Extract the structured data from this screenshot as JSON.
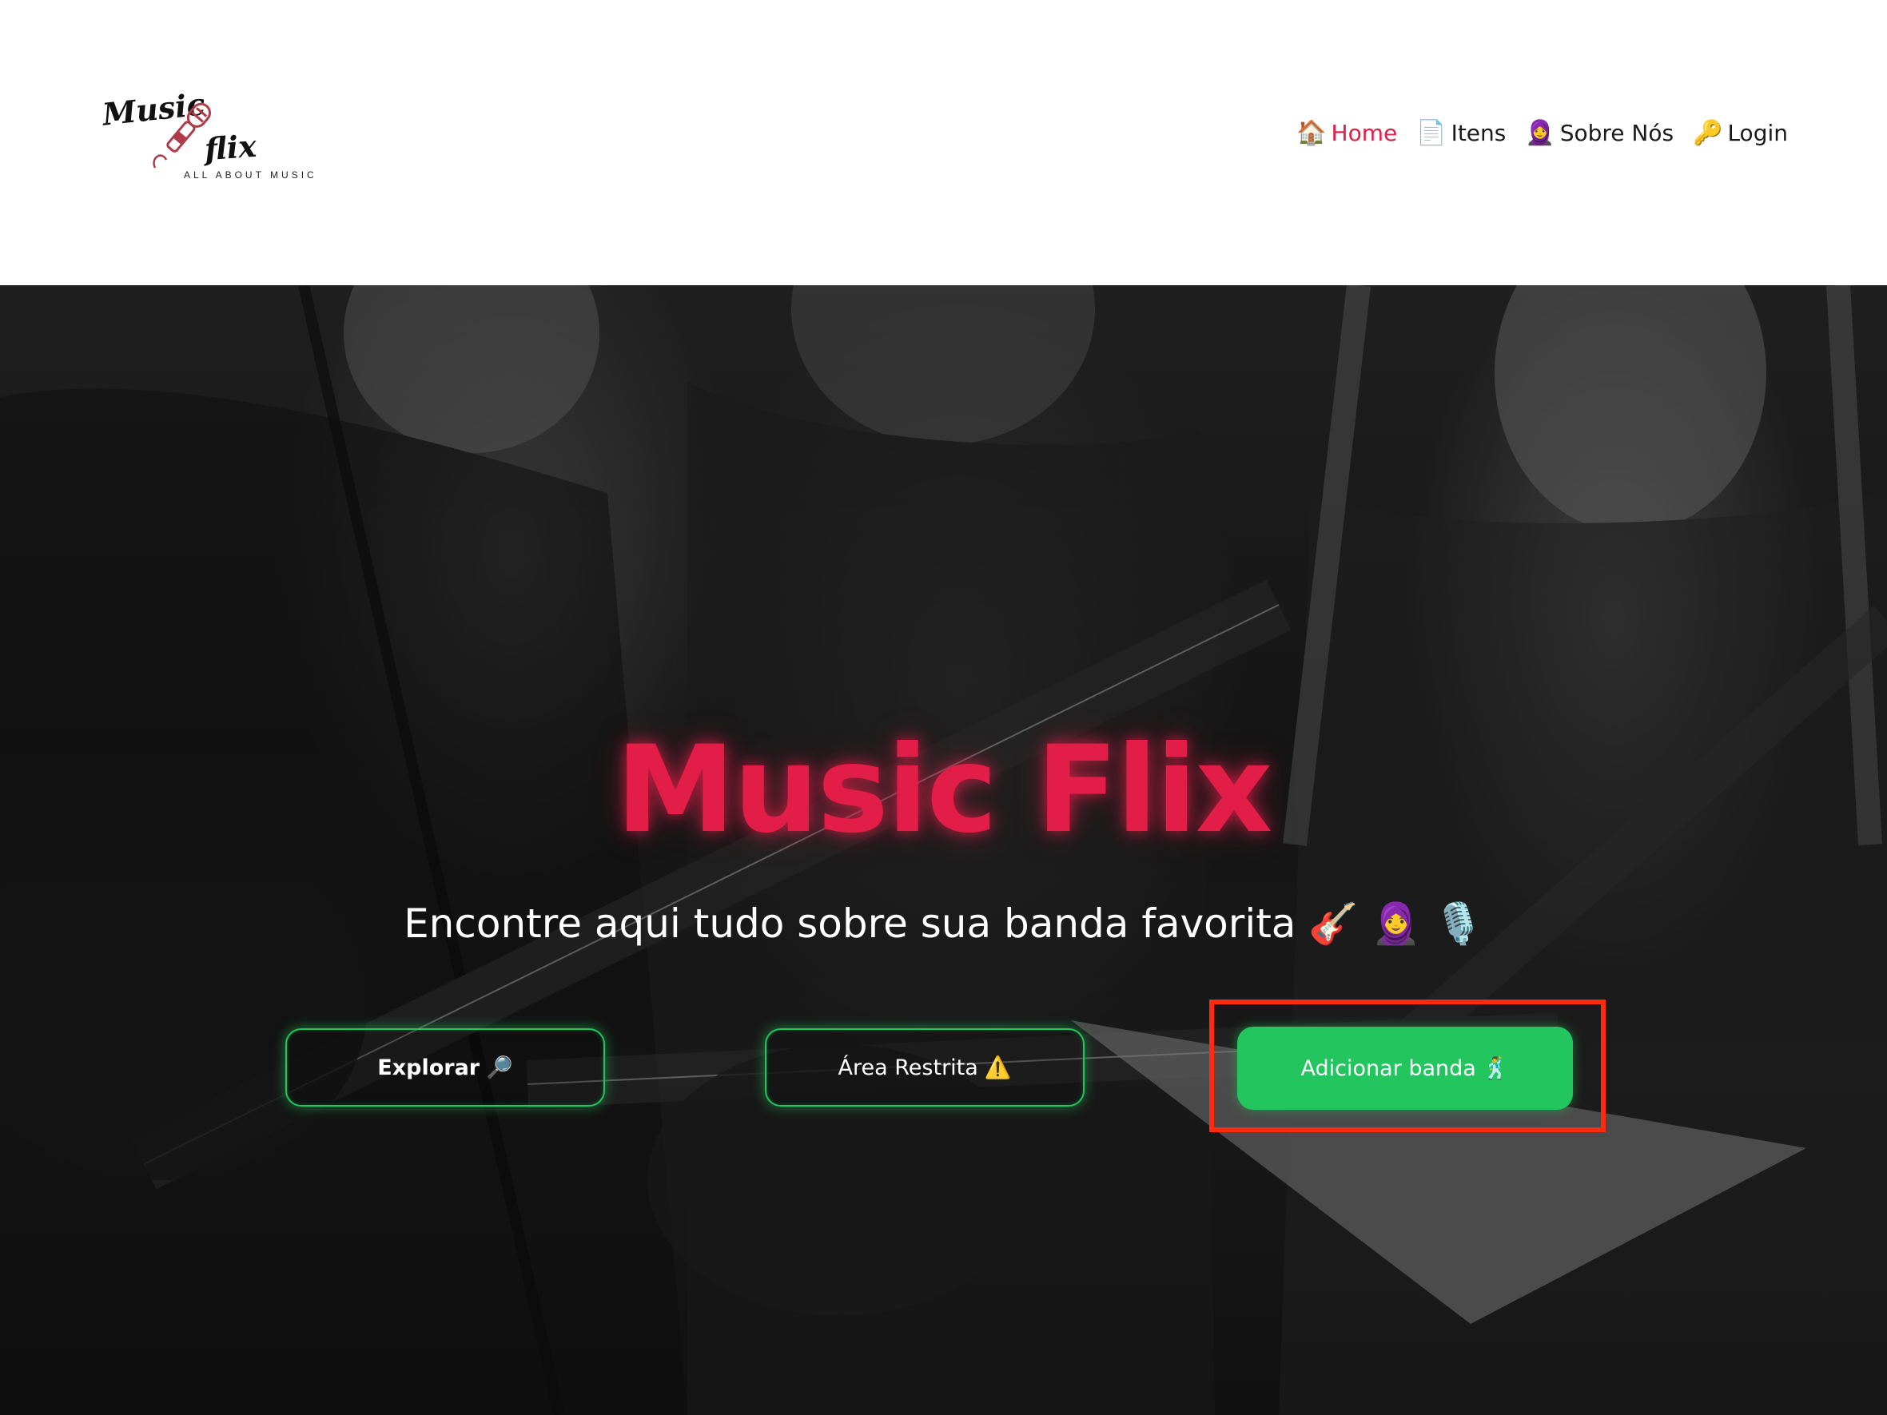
{
  "header": {
    "logo": {
      "word1": "Music",
      "word2": "flix",
      "tagline": "ALL ABOUT MUSIC"
    },
    "nav": [
      {
        "icon": "🏠",
        "icon_name": "house-icon",
        "label": "Home",
        "active": true
      },
      {
        "icon": "📄",
        "icon_name": "document-icon",
        "label": "Itens",
        "active": false
      },
      {
        "icon": "🧕",
        "icon_name": "person-icon",
        "label": "Sobre Nós",
        "active": false
      },
      {
        "icon": "🔑",
        "icon_name": "key-icon",
        "label": "Login",
        "active": false
      }
    ]
  },
  "hero": {
    "title": "Music Flix",
    "subtitle": "Encontre aqui tudo sobre sua banda favorita 🎸 🧕 🎙️",
    "buttons": {
      "explore": {
        "label": "Explorar",
        "icon": "🔎"
      },
      "restricted": {
        "label": "Área Restrita",
        "icon": "⚠️"
      },
      "add_band": {
        "label": "Adicionar banda",
        "icon": "🕺"
      }
    }
  },
  "colors": {
    "accent": "#e11d48",
    "green": "#22c55e",
    "highlight": "#ff2a10"
  }
}
